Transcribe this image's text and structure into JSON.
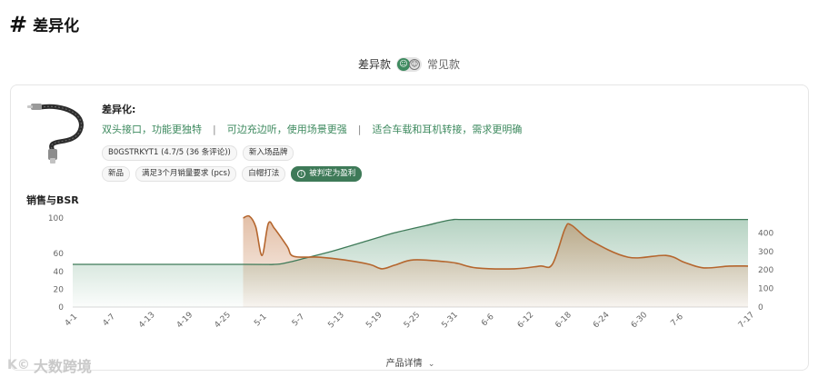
{
  "header": {
    "hash": "#",
    "title": "差异化"
  },
  "toggle": {
    "active_label": "差异款",
    "inactive_label": "常见款",
    "knob_glyph": "☺",
    "off_glyph": "☺"
  },
  "product": {
    "heading": "差异化:",
    "points": [
      "双头接口，功能更独特",
      "可边充边听，使用场景更强",
      "适合车载和耳机转接，需求更明确"
    ],
    "separator": "|",
    "tags_row1": [
      "B0GSTRKYT1 (4.7/5 (36 条评论))",
      "新入场品牌"
    ],
    "tags_row2": [
      "新品",
      "满足3个月销量要求 (pcs)",
      "白帽打法"
    ],
    "profit_tag": "被判定为盈利",
    "profit_icon": "i"
  },
  "chart_section": {
    "title": "销售与BSR"
  },
  "footer": {
    "details_label": "产品详情",
    "chevron": "⌄"
  },
  "watermark": {
    "logo": "K©",
    "text": "大数跨境"
  },
  "colors": {
    "accent_green": "#3e7a58",
    "sales_line": "#b5662e",
    "bsr_line": "#3e7a58"
  },
  "chart_data": {
    "type": "area",
    "x_ticks": [
      "4-1",
      "4-7",
      "4-13",
      "4-19",
      "4-25",
      "5-1",
      "5-7",
      "5-13",
      "5-19",
      "5-25",
      "5-31",
      "6-6",
      "6-12",
      "6-18",
      "6-24",
      "6-30",
      "7-6",
      "7-17"
    ],
    "left_axis": {
      "ticks": [
        "0",
        "20",
        "40",
        "60",
        "100"
      ],
      "ylim": [
        0,
        100
      ]
    },
    "right_axis": {
      "ticks": [
        "0",
        "100",
        "200",
        "300",
        "400"
      ],
      "ylim": [
        0,
        480
      ]
    },
    "series": [
      {
        "axis": "right",
        "style": "green-area",
        "points": [
          [
            "4-1",
            230
          ],
          [
            "4-28",
            230
          ],
          [
            "5-3",
            230
          ],
          [
            "5-5",
            240
          ],
          [
            "5-8",
            265
          ],
          [
            "5-12",
            300
          ],
          [
            "5-17",
            350
          ],
          [
            "5-22",
            400
          ],
          [
            "5-27",
            440
          ],
          [
            "5-31",
            470
          ],
          [
            "6-3",
            472
          ],
          [
            "6-20",
            472
          ],
          [
            "7-17",
            472
          ]
        ]
      },
      {
        "axis": "left",
        "style": "brown-area",
        "points": [
          [
            "4-28",
            100
          ],
          [
            "4-29",
            102
          ],
          [
            "4-30",
            90
          ],
          [
            "5-1",
            58
          ],
          [
            "5-2",
            94
          ],
          [
            "5-3",
            88
          ],
          [
            "5-5",
            68
          ],
          [
            "5-6",
            57
          ],
          [
            "5-10",
            56
          ],
          [
            "5-14",
            53
          ],
          [
            "5-18",
            48
          ],
          [
            "5-20",
            43
          ],
          [
            "5-22",
            47
          ],
          [
            "5-25",
            53
          ],
          [
            "5-30",
            51
          ],
          [
            "6-1",
            49
          ],
          [
            "6-4",
            44
          ],
          [
            "6-10",
            43
          ],
          [
            "6-14",
            46
          ],
          [
            "6-16",
            48
          ],
          [
            "6-18",
            88
          ],
          [
            "6-19",
            92
          ],
          [
            "6-22",
            75
          ],
          [
            "6-28",
            56
          ],
          [
            "7-4",
            58
          ],
          [
            "7-7",
            50
          ],
          [
            "7-10",
            44
          ],
          [
            "7-14",
            46
          ],
          [
            "7-17",
            46
          ]
        ]
      }
    ]
  }
}
